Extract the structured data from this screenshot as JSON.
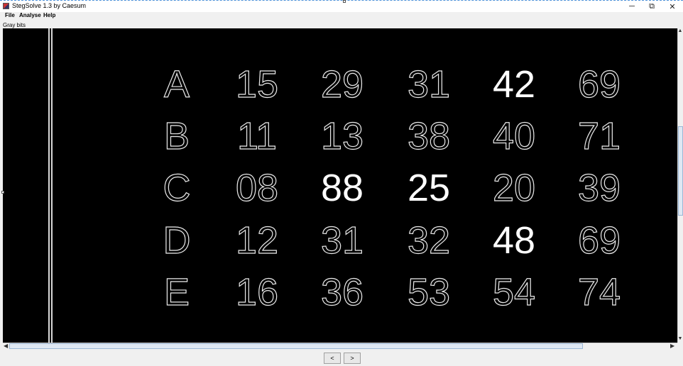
{
  "window": {
    "title": "StegSolve 1.3 by Caesum",
    "minimize": "─",
    "maximize": "⧉",
    "close": "✕"
  },
  "menu": [
    "File",
    "Analyse",
    "Help"
  ],
  "caption": "Gray bits",
  "grid": {
    "rows": [
      {
        "letter": "A",
        "values": [
          "15",
          "29",
          "31",
          "42",
          "69"
        ]
      },
      {
        "letter": "B",
        "values": [
          "11",
          "13",
          "38",
          "40",
          "71"
        ]
      },
      {
        "letter": "C",
        "values": [
          "08",
          "88",
          "25",
          "20",
          "39"
        ]
      },
      {
        "letter": "D",
        "values": [
          "12",
          "31",
          "32",
          "48",
          "69"
        ]
      },
      {
        "letter": "E",
        "values": [
          "16",
          "36",
          "53",
          "54",
          "74"
        ]
      }
    ],
    "highlighted": [
      "A-3",
      "C-1",
      "C-2",
      "D-3"
    ]
  },
  "nav": {
    "prev": "<",
    "next": ">"
  },
  "scroll": {
    "left_arrow": "◀",
    "right_arrow": "▶",
    "up_arrow": "▲",
    "down_arrow": "▼"
  }
}
